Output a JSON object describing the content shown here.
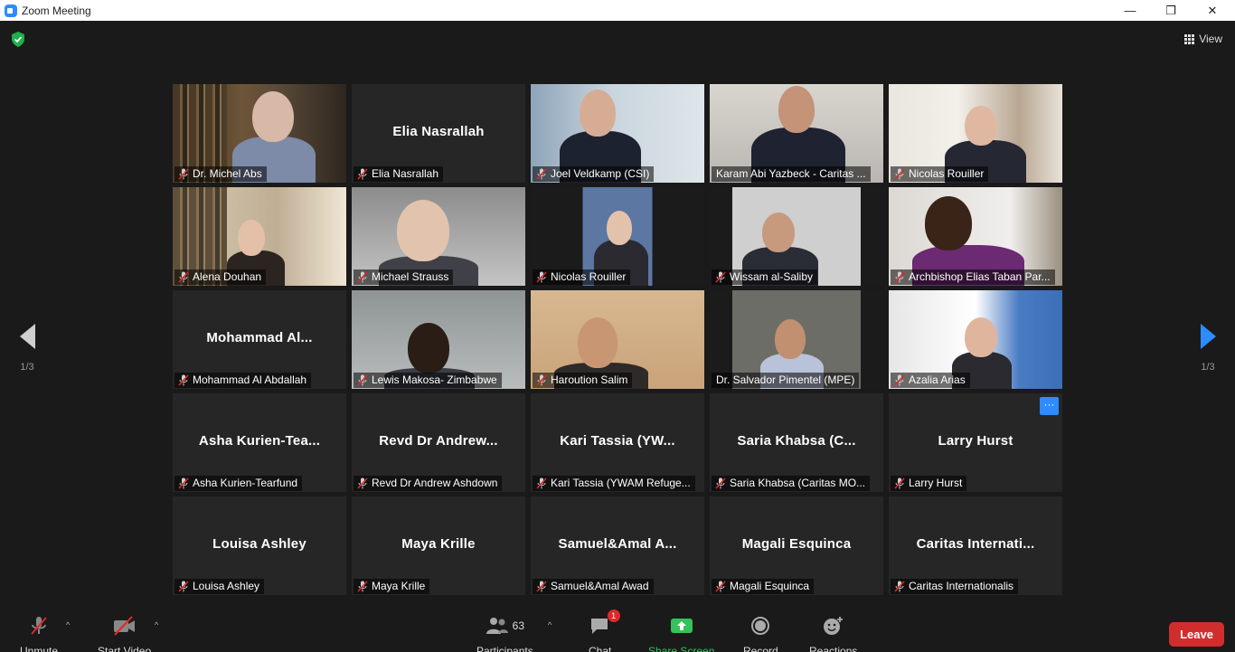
{
  "window": {
    "title": "Zoom Meeting",
    "minimize": "—",
    "maximize": "❐",
    "close": "✕"
  },
  "view": {
    "label": "View"
  },
  "pager": {
    "left_label": "1/3",
    "right_label": "1/3"
  },
  "participants_grid": [
    {
      "display": "",
      "label": "Dr. Michel Abs",
      "video": true,
      "muted": true
    },
    {
      "display": "Elia Nasrallah",
      "label": "Elia Nasrallah",
      "video": false,
      "muted": true
    },
    {
      "display": "",
      "label": "Joel Veldkamp (CSI)",
      "video": true,
      "muted": true
    },
    {
      "display": "",
      "label": "Karam Abi Yazbeck - Caritas ...",
      "video": true,
      "muted": false,
      "active_speaker": true
    },
    {
      "display": "",
      "label": "Nicolas Rouiller",
      "video": true,
      "muted": true
    },
    {
      "display": "",
      "label": "Alena Douhan",
      "video": true,
      "muted": true
    },
    {
      "display": "",
      "label": "Michael Strauss",
      "video": true,
      "muted": true
    },
    {
      "display": "",
      "label": "Nicolas Rouiller",
      "video": true,
      "muted": true
    },
    {
      "display": "",
      "label": "Wissam al-Saliby",
      "video": true,
      "muted": true
    },
    {
      "display": "",
      "label": "Archbishop Elias Taban Par...",
      "video": true,
      "muted": true
    },
    {
      "display": "Mohammad  Al...",
      "label": "Mohammad Al Abdallah",
      "video": false,
      "muted": true
    },
    {
      "display": "",
      "label": "Lewis Makosa- Zimbabwe",
      "video": true,
      "muted": true
    },
    {
      "display": "",
      "label": "Haroution Salim",
      "video": true,
      "muted": true
    },
    {
      "display": "",
      "label": "Dr. Salvador Pimentel (MPE)",
      "video": true,
      "muted": false
    },
    {
      "display": "",
      "label": "Azalia Arias",
      "video": true,
      "muted": true
    },
    {
      "display": "Asha  Kurien-Tea...",
      "label": "Asha Kurien-Tearfund",
      "video": false,
      "muted": true
    },
    {
      "display": "Revd  Dr  Andrew...",
      "label": "Revd Dr Andrew Ashdown",
      "video": false,
      "muted": true
    },
    {
      "display": "Kari  Tassia  (YW...",
      "label": "Kari Tassia (YWAM Refuge...",
      "video": false,
      "muted": true
    },
    {
      "display": "Saria  Khabsa  (C...",
      "label": "Saria Khabsa (Caritas MO...",
      "video": false,
      "muted": true
    },
    {
      "display": "Larry  Hurst",
      "label": "Larry Hurst",
      "video": false,
      "muted": true,
      "more": "···"
    },
    {
      "display": "Louisa  Ashley",
      "label": "Louisa Ashley",
      "video": false,
      "muted": true
    },
    {
      "display": "Maya  Krille",
      "label": "Maya Krille",
      "video": false,
      "muted": true
    },
    {
      "display": "Samuel&Amal  A...",
      "label": "Samuel&Amal Awad",
      "video": false,
      "muted": true
    },
    {
      "display": "Magali  Esquinca",
      "label": "Magali Esquinca",
      "video": false,
      "muted": true
    },
    {
      "display": "Caritas  Internati...",
      "label": "Caritas Internationalis",
      "video": false,
      "muted": true
    }
  ],
  "toolbar": {
    "unmute": "Unmute",
    "start_video": "Start Video",
    "participants": "Participants",
    "participants_count": "63",
    "chat": "Chat",
    "chat_badge": "1",
    "share_screen": "Share Screen",
    "record": "Record",
    "reactions": "Reactions",
    "leave": "Leave"
  },
  "colors": {
    "accent": "#2d8cff",
    "share_green": "#35c25a",
    "leave_red": "#d12d2d",
    "muted_red": "#e02828",
    "active_speaker": "#c5e36a",
    "security_green": "#20b04b"
  }
}
